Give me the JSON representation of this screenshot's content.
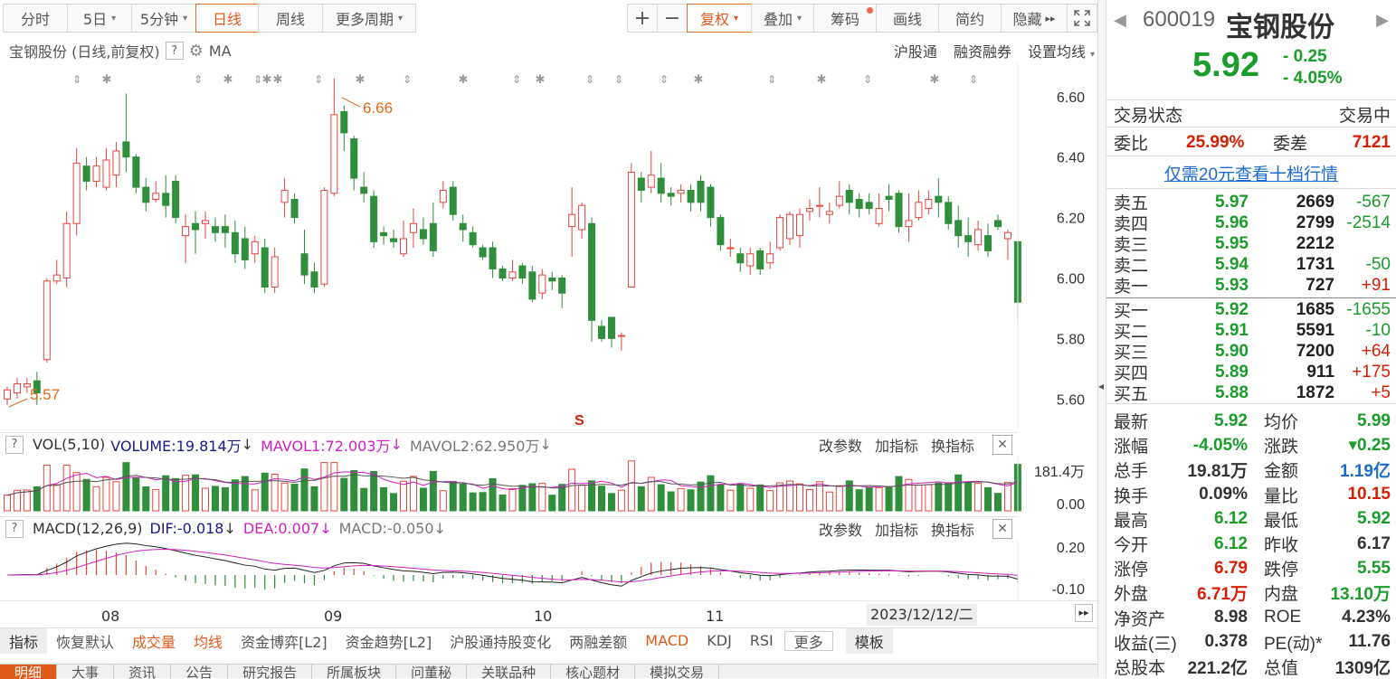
{
  "toolbar": {
    "periods": [
      "分时",
      "5日",
      "5分钟",
      "日线",
      "周线",
      "更多周期"
    ],
    "active_period": "日线",
    "zoom_in": "+",
    "zoom_out": "−",
    "adjust": "复权",
    "overlay": "叠加",
    "chips": "筹码",
    "drawing": "画线",
    "simple": "简约",
    "hide": "隐藏"
  },
  "chart_header": {
    "title": "宝钢股份 (日线,前复权)",
    "indicator": "MA",
    "links": [
      "沪股通",
      "融资融券",
      "设置均线"
    ]
  },
  "price_axis": [
    "6.60",
    "6.40",
    "6.20",
    "6.00",
    "5.80",
    "5.60"
  ],
  "annotations": {
    "high": "6.66",
    "low": "5.57",
    "marker": "S"
  },
  "vol_pane": {
    "label": "VOL(5,10)",
    "volume": "VOLUME:19.814万",
    "mavol1": "MAVOL1:72.003万",
    "mavol2": "MAVOL2:62.950万",
    "axis_top": "181.4万",
    "axis_bottom": "0.00",
    "tools": [
      "改参数",
      "加指标",
      "换指标"
    ]
  },
  "macd_pane": {
    "label": "MACD(12,26,9)",
    "dif": "DIF:-0.018",
    "dea": "DEA:0.007",
    "macd": "MACD:-0.050",
    "axis_top": "0.20",
    "axis_bottom": "-0.10",
    "tools": [
      "改参数",
      "加指标",
      "换指标"
    ]
  },
  "x_axis": {
    "labels": [
      "08",
      "09",
      "10",
      "11"
    ],
    "cursor_date": "2023/12/12/二"
  },
  "bottom_tabs": [
    "指标",
    "恢复默认",
    "成交量",
    "均线",
    "资金博弈[L2]",
    "资金趋势[L2]",
    "沪股通持股变化",
    "两融差额",
    "MACD",
    "KDJ",
    "RSI",
    "更多",
    "模板"
  ],
  "lower_tabs": [
    "明细",
    "大事",
    "资讯",
    "公告",
    "研究报告",
    "所属板块",
    "问董秘",
    "关联品种",
    "核心题材",
    "模拟交易"
  ],
  "quote": {
    "code": "600019",
    "name": "宝钢股份",
    "price": "5.92",
    "change": "- 0.25",
    "change_pct": "- 4.05%",
    "status_label": "交易状态",
    "status_value": "交易中",
    "ratio_label": "委比",
    "ratio_value": "25.99%",
    "diff_label": "委差",
    "diff_value": "7121",
    "promo": "仅需20元查看十档行情",
    "asks": [
      {
        "label": "卖五",
        "price": "5.97",
        "vol": "2669",
        "chg": "-567"
      },
      {
        "label": "卖四",
        "price": "5.96",
        "vol": "2799",
        "chg": "-2514"
      },
      {
        "label": "卖三",
        "price": "5.95",
        "vol": "2212",
        "chg": ""
      },
      {
        "label": "卖二",
        "price": "5.94",
        "vol": "1731",
        "chg": "-50"
      },
      {
        "label": "卖一",
        "price": "5.93",
        "vol": "727",
        "chg": "+91"
      }
    ],
    "bids": [
      {
        "label": "买一",
        "price": "5.92",
        "vol": "1685",
        "chg": "-1655"
      },
      {
        "label": "买二",
        "price": "5.91",
        "vol": "5591",
        "chg": "-10"
      },
      {
        "label": "买三",
        "price": "5.90",
        "vol": "7200",
        "chg": "+64"
      },
      {
        "label": "买四",
        "price": "5.89",
        "vol": "911",
        "chg": "+175"
      },
      {
        "label": "买五",
        "price": "5.88",
        "vol": "1872",
        "chg": "+5"
      }
    ],
    "stats": [
      {
        "l1": "最新",
        "v1": "5.92",
        "c1": "down",
        "l2": "均价",
        "v2": "5.99",
        "c2": "down"
      },
      {
        "l1": "涨幅",
        "v1": "-4.05%",
        "c1": "down",
        "l2": "涨跌",
        "v2": "▾0.25",
        "c2": "down"
      },
      {
        "l1": "总手",
        "v1": "19.81万",
        "c1": "",
        "l2": "金额",
        "v2": "1.19亿",
        "c2": "blue"
      },
      {
        "l1": "换手",
        "v1": "0.09%",
        "c1": "",
        "l2": "量比",
        "v2": "10.15",
        "c2": "up"
      },
      {
        "l1": "最高",
        "v1": "6.12",
        "c1": "down",
        "l2": "最低",
        "v2": "5.92",
        "c2": "down"
      },
      {
        "l1": "今开",
        "v1": "6.12",
        "c1": "down",
        "l2": "昨收",
        "v2": "6.17",
        "c2": ""
      },
      {
        "l1": "涨停",
        "v1": "6.79",
        "c1": "up",
        "l2": "跌停",
        "v2": "5.55",
        "c2": "down"
      },
      {
        "l1": "外盘",
        "v1": "6.71万",
        "c1": "up",
        "l2": "内盘",
        "v2": "13.10万",
        "c2": "down"
      },
      {
        "l1": "净资产",
        "v1": "8.98",
        "c1": "",
        "l2": "ROE",
        "v2": "4.23%",
        "c2": ""
      },
      {
        "l1": "收益(三)",
        "v1": "0.378",
        "c1": "",
        "l2": "PE(动)*",
        "v2": "11.76",
        "c2": ""
      },
      {
        "l1": "总股本",
        "v1": "221.2亿",
        "c1": "",
        "l2": "总值",
        "v2": "1309亿",
        "c2": ""
      }
    ]
  },
  "colors": {
    "up": "#d81e06",
    "down": "#1a9d2a",
    "accent": "#e05a1a",
    "candle_up": "#e8453c",
    "candle_down": "#2f8f3a",
    "link": "#1a6cd0"
  },
  "chart_data": {
    "type": "candlestick",
    "ylim": [
      5.55,
      6.68
    ],
    "candles": [
      [
        5.6,
        5.63,
        5.58,
        5.64
      ],
      [
        5.62,
        5.65,
        5.6,
        5.67
      ],
      [
        5.64,
        5.65,
        5.62,
        5.67
      ],
      [
        5.66,
        5.62,
        5.58,
        5.69
      ],
      [
        5.73,
        5.99,
        5.72,
        6.0
      ],
      [
        5.99,
        6.01,
        5.98,
        6.06
      ],
      [
        6.0,
        6.18,
        5.97,
        6.22
      ],
      [
        6.18,
        6.38,
        6.14,
        6.43
      ],
      [
        6.37,
        6.32,
        6.29,
        6.4
      ],
      [
        6.32,
        6.37,
        6.3,
        6.4
      ],
      [
        6.3,
        6.39,
        6.29,
        6.43
      ],
      [
        6.34,
        6.42,
        6.3,
        6.45
      ],
      [
        6.45,
        6.4,
        6.35,
        6.61
      ],
      [
        6.4,
        6.3,
        6.28,
        6.41
      ],
      [
        6.3,
        6.25,
        6.22,
        6.33
      ],
      [
        6.26,
        6.28,
        6.25,
        6.32
      ],
      [
        6.28,
        6.24,
        6.2,
        6.34
      ],
      [
        6.32,
        6.2,
        6.18,
        6.34
      ],
      [
        6.14,
        6.17,
        6.05,
        6.21
      ],
      [
        6.18,
        6.16,
        6.08,
        6.22
      ],
      [
        6.18,
        6.19,
        6.13,
        6.22
      ],
      [
        6.17,
        6.15,
        6.12,
        6.2
      ],
      [
        6.17,
        6.15,
        6.1,
        6.21
      ],
      [
        6.15,
        6.08,
        6.05,
        6.19
      ],
      [
        6.13,
        6.06,
        6.03,
        6.17
      ],
      [
        6.08,
        6.12,
        6.05,
        6.14
      ],
      [
        6.1,
        5.97,
        5.95,
        6.13
      ],
      [
        5.97,
        6.07,
        5.95,
        6.1
      ],
      [
        6.25,
        6.29,
        6.2,
        6.33
      ],
      [
        6.26,
        6.2,
        6.18,
        6.28
      ],
      [
        6.08,
        6.01,
        5.98,
        6.16
      ],
      [
        6.02,
        5.97,
        5.95,
        6.05
      ],
      [
        5.98,
        6.29,
        5.97,
        6.3
      ],
      [
        6.28,
        6.54,
        6.27,
        6.66
      ],
      [
        6.55,
        6.48,
        6.42,
        6.57
      ],
      [
        6.46,
        6.33,
        6.29,
        6.47
      ],
      [
        6.3,
        6.28,
        6.25,
        6.35
      ],
      [
        6.27,
        6.12,
        6.1,
        6.29
      ],
      [
        6.15,
        6.14,
        6.11,
        6.17
      ],
      [
        6.13,
        6.12,
        6.1,
        6.16
      ],
      [
        6.08,
        6.13,
        6.07,
        6.19
      ],
      [
        6.15,
        6.18,
        6.1,
        6.23
      ],
      [
        6.16,
        6.13,
        6.11,
        6.2
      ],
      [
        6.18,
        6.09,
        6.07,
        6.25
      ],
      [
        6.25,
        6.29,
        6.23,
        6.32
      ],
      [
        6.3,
        6.21,
        6.19,
        6.32
      ],
      [
        6.18,
        6.16,
        6.12,
        6.21
      ],
      [
        6.15,
        6.11,
        6.1,
        6.17
      ],
      [
        6.1,
        6.07,
        6.06,
        6.11
      ],
      [
        6.1,
        6.03,
        6.0,
        6.12
      ],
      [
        6.03,
        6.0,
        5.99,
        6.04
      ],
      [
        6.0,
        6.02,
        5.99,
        6.06
      ],
      [
        6.04,
        6.0,
        5.98,
        6.05
      ],
      [
        6.02,
        5.93,
        5.92,
        6.04
      ],
      [
        5.95,
        6.01,
        5.93,
        6.03
      ],
      [
        6.0,
        5.99,
        5.96,
        6.02
      ],
      [
        6.0,
        5.95,
        5.9,
        6.01
      ],
      [
        6.17,
        6.21,
        6.07,
        6.3
      ],
      [
        6.16,
        6.24,
        6.13,
        6.25
      ],
      [
        6.18,
        5.86,
        5.79,
        6.2
      ],
      [
        5.84,
        5.8,
        5.79,
        5.86
      ],
      [
        5.87,
        5.8,
        5.77,
        5.83
      ],
      [
        5.81,
        5.81,
        5.76,
        5.82
      ],
      [
        5.97,
        6.35,
        5.98,
        6.38
      ],
      [
        6.33,
        6.29,
        6.25,
        6.35
      ],
      [
        6.3,
        6.34,
        6.28,
        6.42
      ],
      [
        6.33,
        6.28,
        6.25,
        6.38
      ],
      [
        6.28,
        6.27,
        6.24,
        6.3
      ],
      [
        6.28,
        6.29,
        6.25,
        6.31
      ],
      [
        6.29,
        6.25,
        6.22,
        6.31
      ],
      [
        6.32,
        6.25,
        6.22,
        6.34
      ],
      [
        6.3,
        6.2,
        6.17,
        6.31
      ],
      [
        6.2,
        6.11,
        6.09,
        6.21
      ],
      [
        6.1,
        6.1,
        6.07,
        6.13
      ],
      [
        6.08,
        6.05,
        6.02,
        6.1
      ],
      [
        6.04,
        6.08,
        6.01,
        6.1
      ],
      [
        6.09,
        6.03,
        6.01,
        6.1
      ],
      [
        6.05,
        6.08,
        6.03,
        6.12
      ],
      [
        6.1,
        6.2,
        6.09,
        6.21
      ],
      [
        6.13,
        6.21,
        6.11,
        6.22
      ],
      [
        6.14,
        6.21,
        6.1,
        6.23
      ],
      [
        6.22,
        6.23,
        6.19,
        6.26
      ],
      [
        6.24,
        6.24,
        6.2,
        6.3
      ],
      [
        6.21,
        6.22,
        6.18,
        6.25
      ],
      [
        6.24,
        6.27,
        6.23,
        6.32
      ],
      [
        6.29,
        6.25,
        6.21,
        6.31
      ],
      [
        6.26,
        6.23,
        6.2,
        6.28
      ],
      [
        6.25,
        6.23,
        6.21,
        6.28
      ],
      [
        6.18,
        6.23,
        6.17,
        6.28
      ],
      [
        6.27,
        6.26,
        6.22,
        6.31
      ],
      [
        6.28,
        6.17,
        6.15,
        6.29
      ],
      [
        6.17,
        6.19,
        6.12,
        6.28
      ],
      [
        6.2,
        6.25,
        6.19,
        6.29
      ],
      [
        6.23,
        6.26,
        6.21,
        6.29
      ],
      [
        6.27,
        6.25,
        6.2,
        6.33
      ],
      [
        6.25,
        6.18,
        6.16,
        6.27
      ],
      [
        6.19,
        6.14,
        6.1,
        6.24
      ],
      [
        6.14,
        6.12,
        6.07,
        6.2
      ],
      [
        6.11,
        6.16,
        6.09,
        6.19
      ],
      [
        6.14,
        6.09,
        6.07,
        6.18
      ],
      [
        6.19,
        6.17,
        6.16,
        6.21
      ],
      [
        6.13,
        6.15,
        6.06,
        6.16
      ],
      [
        6.12,
        5.92,
        5.86,
        6.12
      ]
    ]
  }
}
